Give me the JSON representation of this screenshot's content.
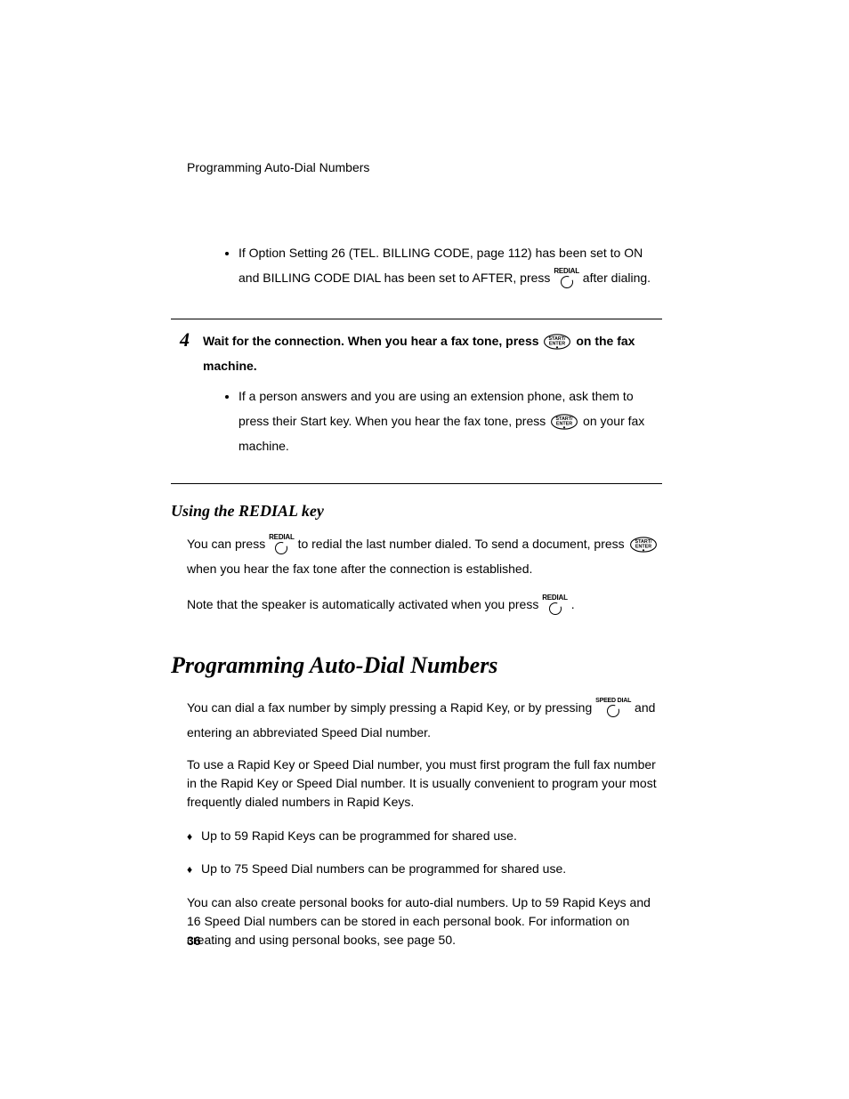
{
  "header": {
    "running": "Programming Auto-Dial Numbers"
  },
  "keys": {
    "redial": "REDIAL",
    "start_enter_top": "START/",
    "start_enter_bot": "ENTER",
    "speed_dial": "SPEED DIAL"
  },
  "note1": {
    "a": "If Option Setting 26 (TEL. BILLING CODE, page 112) has been set to ON and BILLING CODE DIAL has been set to AFTER, press ",
    "b": " after dialing."
  },
  "step4": {
    "num": "4",
    "lead_a": "Wait for the connection. When you hear a fax tone, press ",
    "lead_b": " on the fax machine.",
    "sub_a": "If a person answers and you are using an extension phone, ask them to press their Start key. When you hear the fax tone, press ",
    "sub_b": " on your fax machine."
  },
  "redial_section": {
    "heading": "Using the REDIAL key",
    "p1_a": "You can press ",
    "p1_b": " to redial the last number dialed. To send a document, press ",
    "p1_c": " when you hear the fax tone after the connection is established.",
    "p2_a": "Note that the speaker is automatically activated when you press ",
    "p2_b": "."
  },
  "main_section": {
    "heading": "Programming Auto-Dial Numbers",
    "p1_a": "You can dial a fax number by simply pressing a Rapid Key, or by pressing ",
    "p1_b": " and entering an abbreviated Speed Dial number.",
    "p2": "To use a Rapid Key or Speed Dial number, you must first program the full fax number in the Rapid Key or Speed Dial number. It is usually convenient to program your most frequently dialed numbers in Rapid Keys.",
    "b1": "Up to 59 Rapid Keys can be programmed for shared use.",
    "b2": "Up to 75 Speed Dial numbers can be programmed for shared use.",
    "p3": "You can also create personal books for auto-dial numbers. Up to 59 Rapid Keys and 16 Speed Dial numbers can be stored in each personal book. For information on creating and using personal books, see page 50."
  },
  "page": "36"
}
